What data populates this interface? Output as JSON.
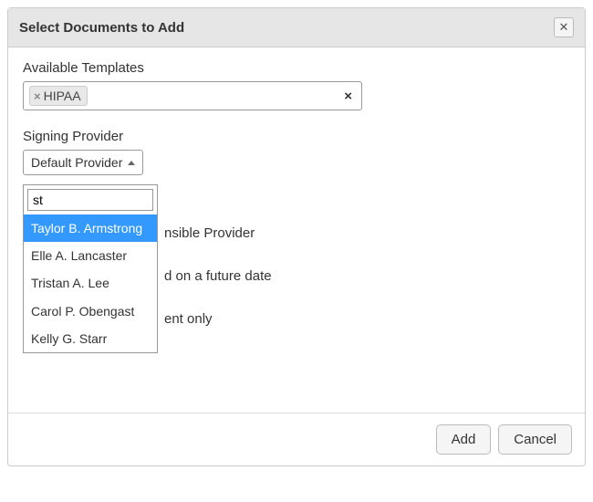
{
  "dialog": {
    "title": "Select Documents to Add"
  },
  "templates": {
    "label": "Available Templates",
    "selected": "HIPAA"
  },
  "provider": {
    "label": "Signing Provider",
    "button_text": "Default Provider",
    "search_value": "st",
    "options": [
      "Taylor B. Armstrong",
      "Elle A. Lancaster",
      "Tristan A. Lee",
      "Carol P. Obengast",
      "Kelly G. Starr"
    ]
  },
  "body_lines": {
    "l1": "nsible Provider",
    "l2": "d on a future date",
    "l3": "ent only"
  },
  "footer": {
    "add": "Add",
    "cancel": "Cancel"
  }
}
